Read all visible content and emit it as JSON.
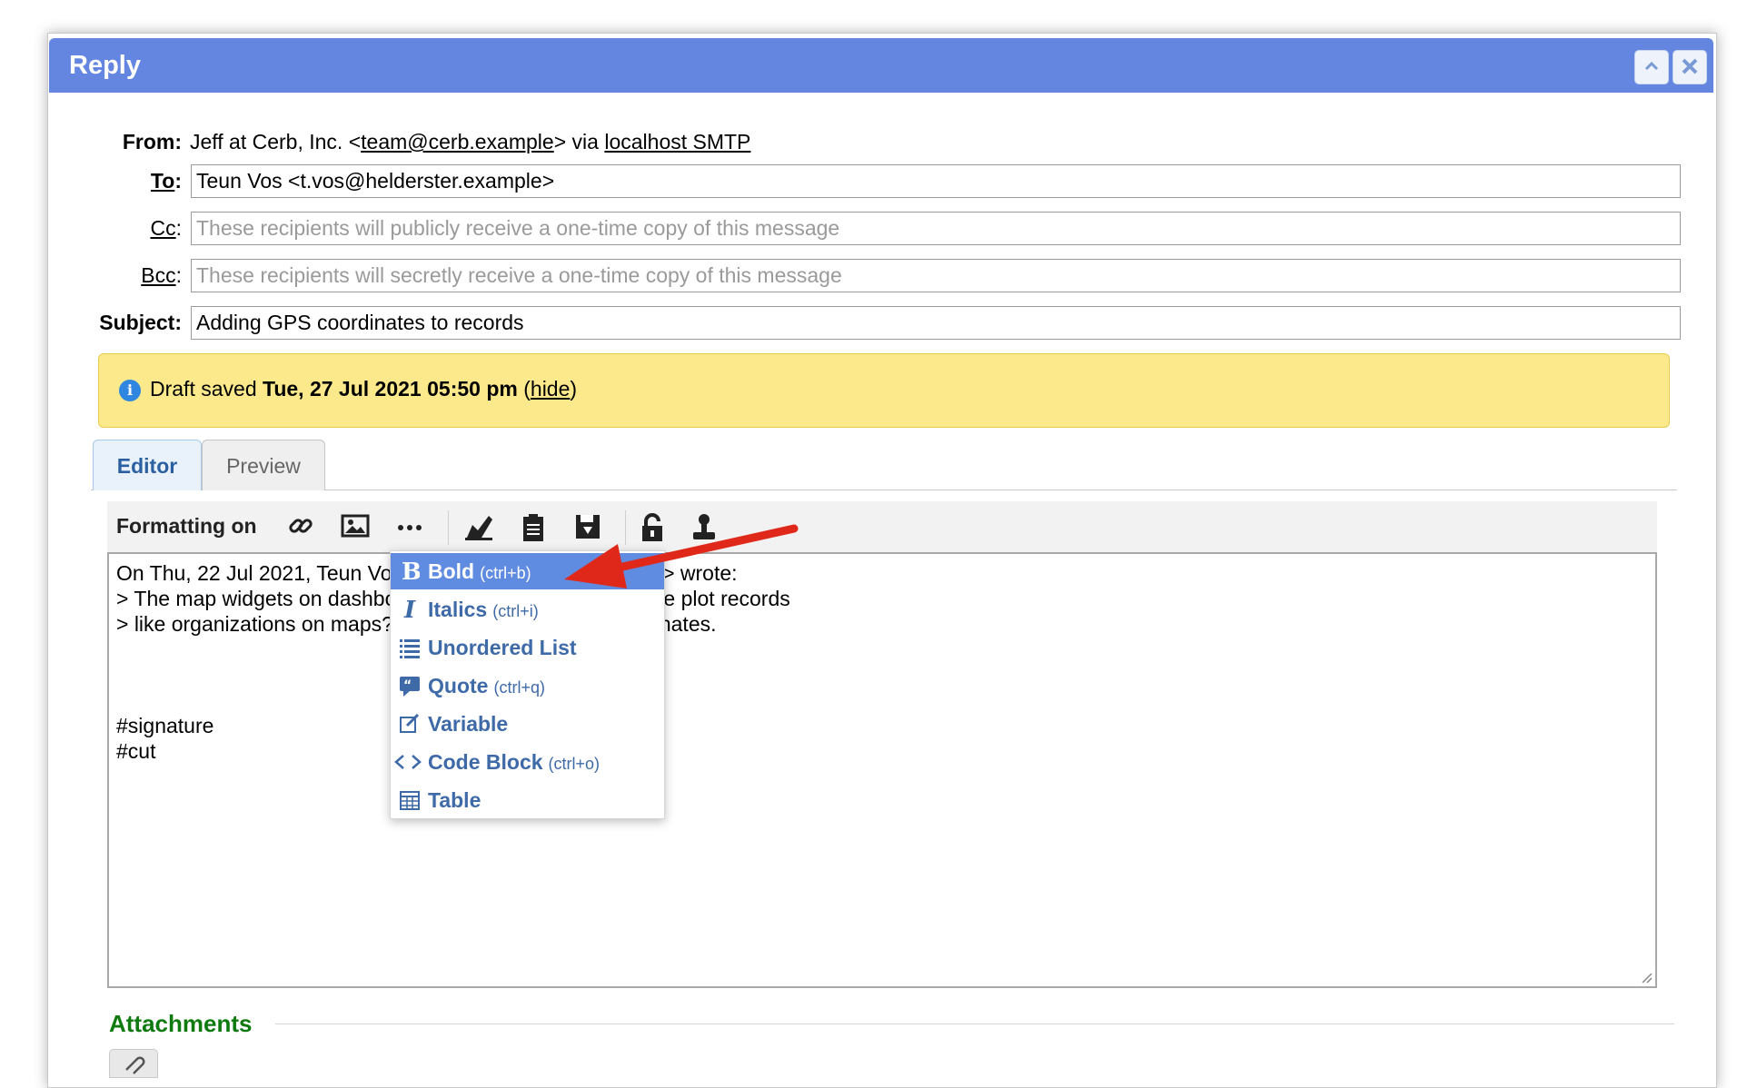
{
  "window": {
    "title": "Reply",
    "btn_collapse": "^",
    "btn_close": "✕"
  },
  "header": {
    "from_label": "From:",
    "from_name": "Jeff at Cerb, Inc. <",
    "from_email": "team@cerb.example",
    "from_via": "> via ",
    "from_transport": "localhost SMTP",
    "to_label": "To",
    "to_value": "Teun Vos <t.vos@helderster.example>",
    "cc_label": "Cc",
    "cc_placeholder": "These recipients will publicly receive a one-time copy of this message",
    "bcc_label": "Bcc",
    "bcc_placeholder": "These recipients will secretly receive a one-time copy of this message",
    "subject_label": "Subject:",
    "subject_value": "Adding GPS coordinates to records"
  },
  "draft_notice": {
    "prefix": "Draft saved ",
    "timestamp": "Tue, 27 Jul 2021 05:50 pm",
    "open_paren": " (",
    "hide_link": "hide",
    "close_paren": ")"
  },
  "tabs": [
    {
      "label": "Editor"
    },
    {
      "label": "Preview"
    }
  ],
  "toolbar": {
    "formatting_label": "Formatting on"
  },
  "editor": {
    "lines": [
      "On Thu, 22 Jul 2021, Teun Vos <t.vos@helderster.example> wrote:",
      "> The map widgets on dashboards are great. But how do we plot records",
      "> like organizations on maps? They don't have GPS coordinates.",
      "",
      "",
      "",
      "#signature",
      "#cut"
    ]
  },
  "format_menu": {
    "items": [
      {
        "label": "Bold",
        "shortcut": "(ctrl+b)",
        "icon": "bold-icon"
      },
      {
        "label": "Italics",
        "shortcut": "(ctrl+i)",
        "icon": "italic-icon"
      },
      {
        "label": "Unordered List",
        "shortcut": "",
        "icon": "list-icon"
      },
      {
        "label": "Quote",
        "shortcut": "(ctrl+q)",
        "icon": "quote-icon"
      },
      {
        "label": "Variable",
        "shortcut": "",
        "icon": "edit-icon"
      },
      {
        "label": "Code Block",
        "shortcut": "(ctrl+o)",
        "icon": "code-icon"
      },
      {
        "label": "Table",
        "shortcut": "",
        "icon": "table-icon"
      }
    ]
  },
  "attachments": {
    "title": "Attachments"
  },
  "colors": {
    "titlebar": "#6486e0",
    "menu_selected": "#5f8be0",
    "menu_text": "#3e6aa8",
    "attachments": "#0f7a0f",
    "arrow": "#e0281a"
  }
}
